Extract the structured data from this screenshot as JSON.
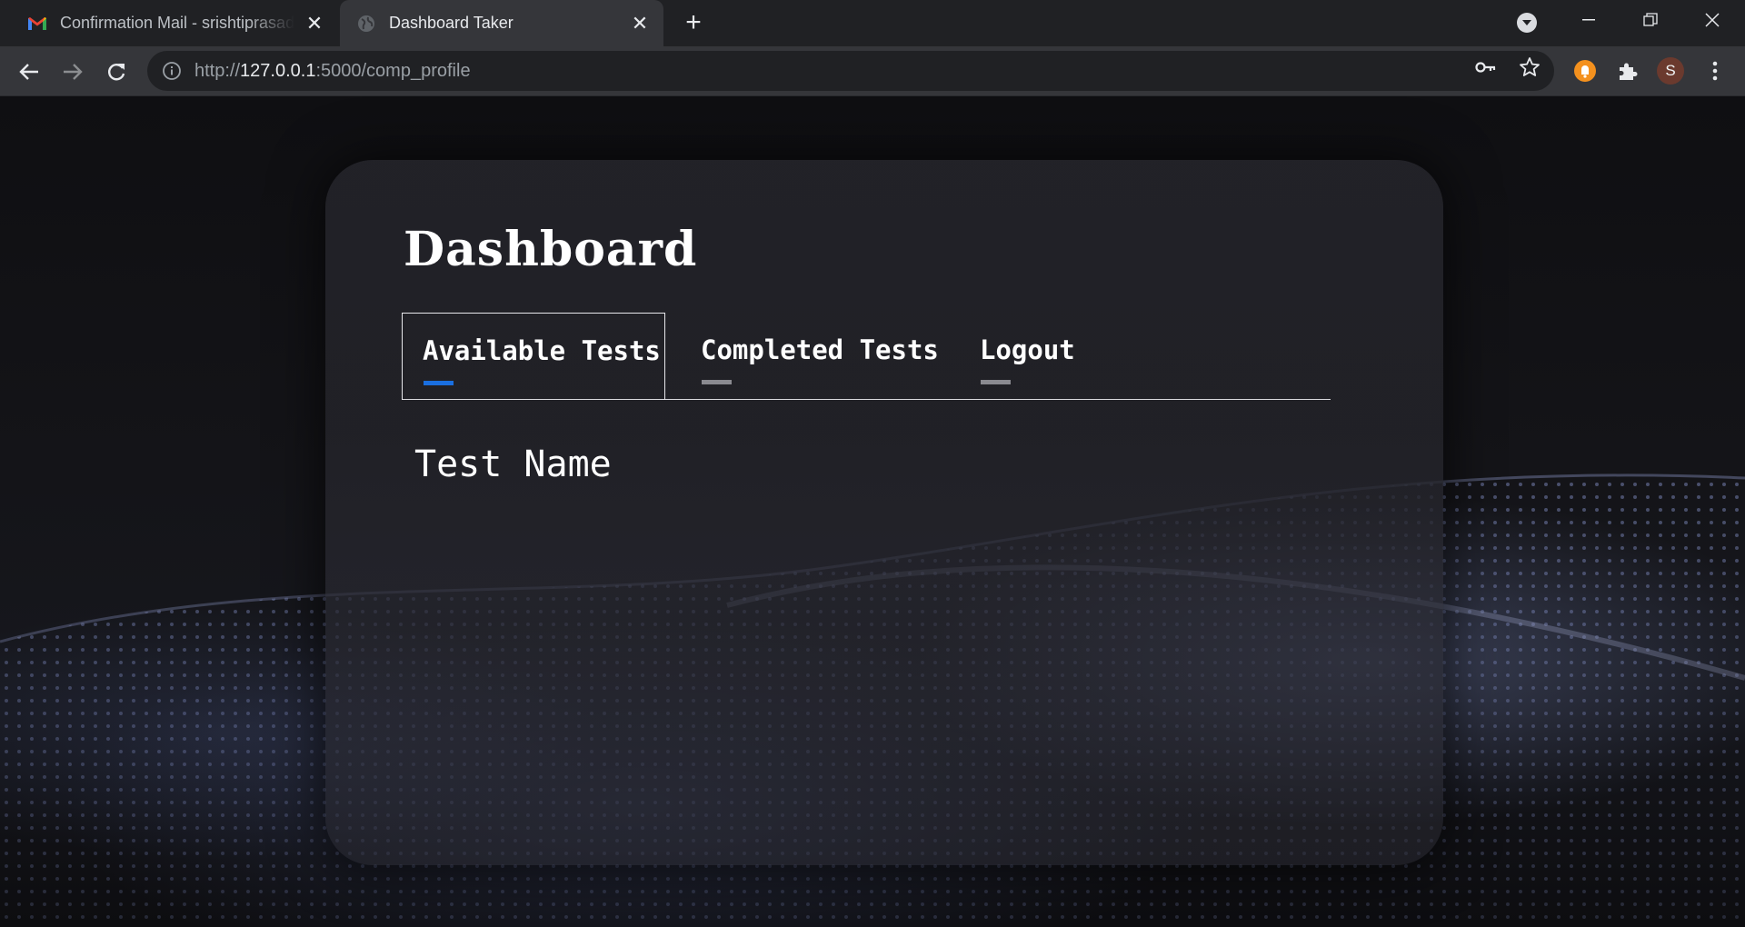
{
  "browser": {
    "tabs": [
      {
        "title": "Confirmation Mail - srishtiprasad",
        "active": false,
        "icon": "gmail-icon"
      },
      {
        "title": "Dashboard Taker",
        "active": true,
        "icon": "globe-icon"
      }
    ],
    "url": {
      "scheme": "http://",
      "host": "127.0.0.1",
      "rest": ":5000/comp_profile"
    },
    "profile_initial": "S"
  },
  "page": {
    "title": "Dashboard",
    "tabs": [
      {
        "label": "Available Tests",
        "selected": true
      },
      {
        "label": "Completed Tests",
        "selected": false
      },
      {
        "label": "Logout",
        "selected": false
      }
    ],
    "table_header": "Test Name"
  },
  "colors": {
    "accent": "#1a6fe0",
    "chrome_dark": "#202124",
    "chrome_toolbar": "#35363a"
  }
}
